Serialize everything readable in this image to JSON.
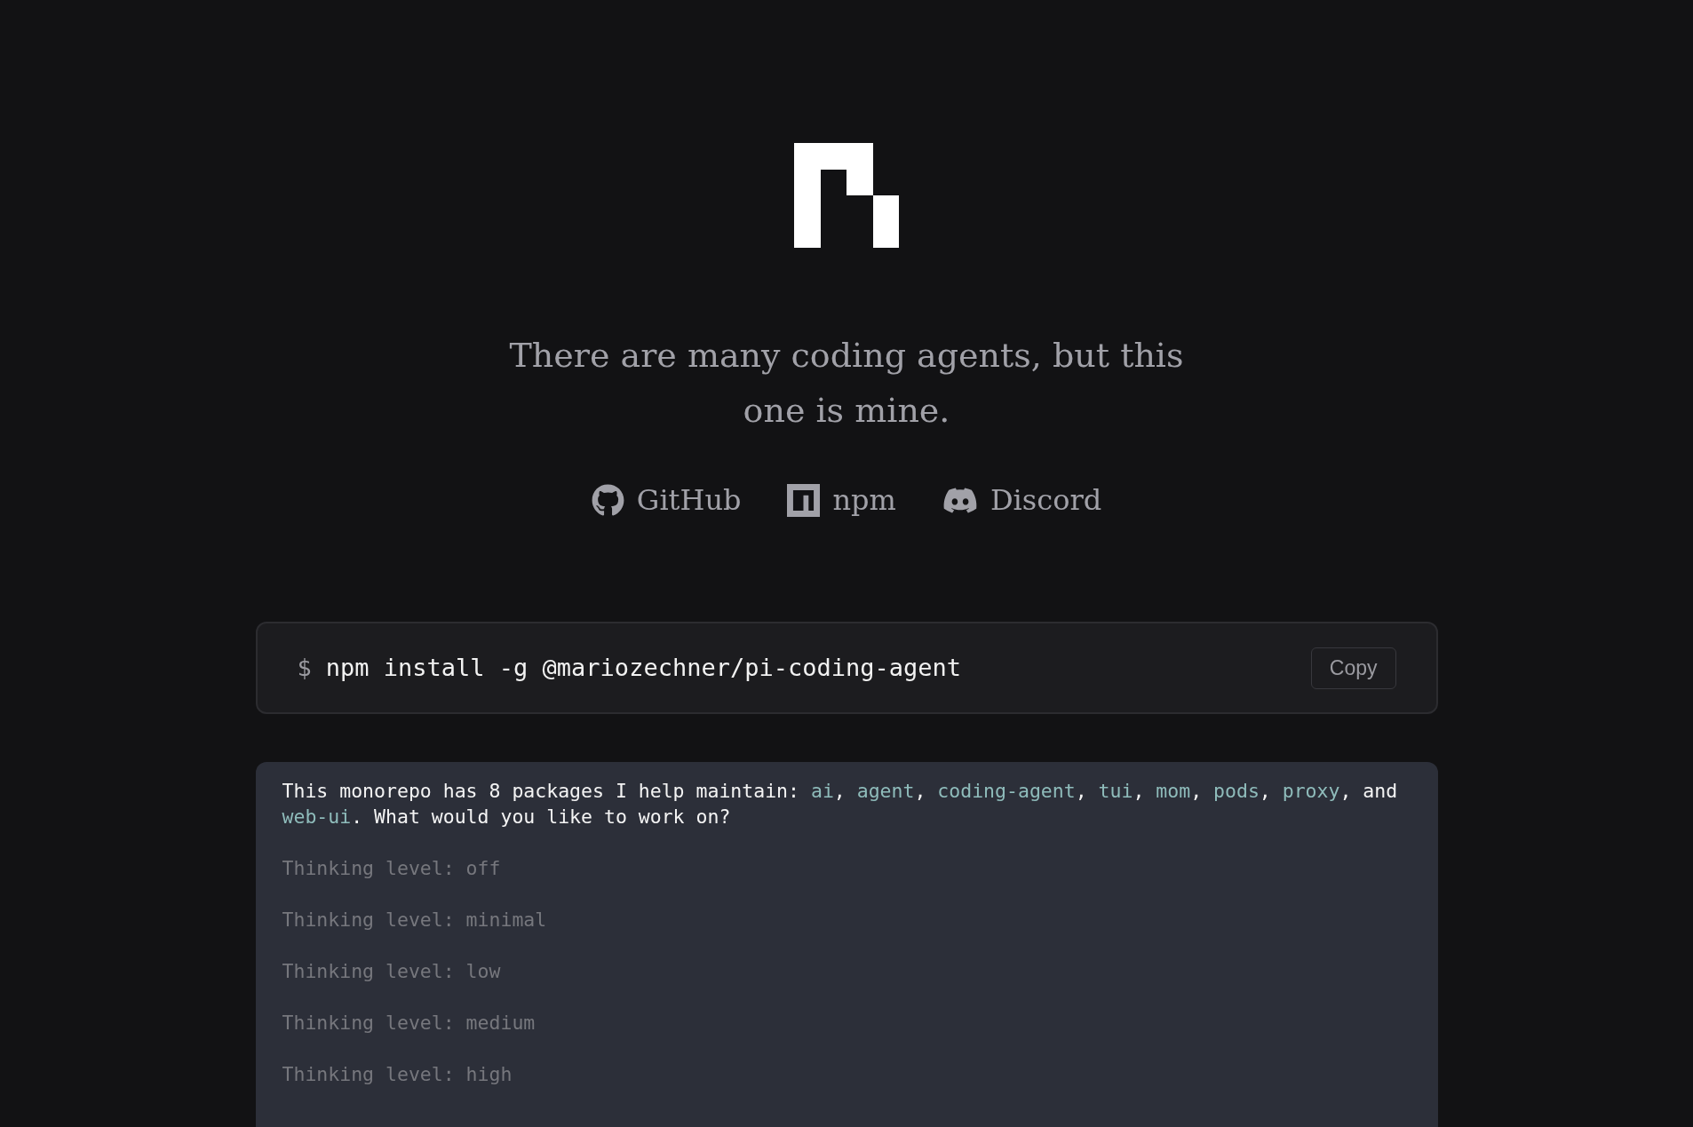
{
  "tagline": "There are many coding agents, but this one is mine.",
  "links": [
    {
      "kind": "github",
      "label": "GitHub"
    },
    {
      "kind": "npm",
      "label": "npm"
    },
    {
      "kind": "discord",
      "label": "Discord"
    }
  ],
  "install": {
    "prompt": "$",
    "command": "npm install -g @mariozechner/pi-coding-agent",
    "button": "Copy"
  },
  "terminal": {
    "message": [
      {
        "kind": "plain",
        "text": "This monorepo has 8 packages I help maintain: "
      },
      {
        "kind": "package",
        "text": "ai"
      },
      {
        "kind": "plain",
        "text": ", "
      },
      {
        "kind": "package",
        "text": "agent"
      },
      {
        "kind": "plain",
        "text": ", "
      },
      {
        "kind": "package",
        "text": "coding-agent"
      },
      {
        "kind": "plain",
        "text": ", "
      },
      {
        "kind": "package",
        "text": "tui"
      },
      {
        "kind": "plain",
        "text": ", "
      },
      {
        "kind": "package",
        "text": "mom"
      },
      {
        "kind": "plain",
        "text": ", "
      },
      {
        "kind": "package",
        "text": "pods"
      },
      {
        "kind": "plain",
        "text": ", "
      },
      {
        "kind": "package",
        "text": "proxy"
      },
      {
        "kind": "plain",
        "text": ", and "
      },
      {
        "kind": "package",
        "text": "web-ui"
      },
      {
        "kind": "plain",
        "text": ". What would you like to work on?"
      }
    ],
    "status_lines": [
      "Thinking level: off",
      "Thinking level: minimal",
      "Thinking level: low",
      "Thinking level: medium",
      "Thinking level: high"
    ]
  }
}
